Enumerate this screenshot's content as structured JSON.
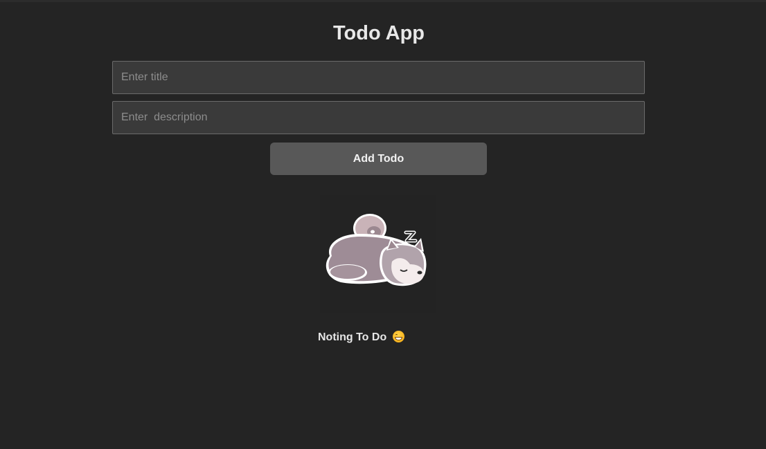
{
  "app": {
    "title": "Todo App"
  },
  "form": {
    "title_placeholder": "Enter title",
    "title_value": "",
    "description_placeholder": "Enter  description",
    "description_value": "",
    "add_button_label": "Add Todo"
  },
  "empty_state": {
    "illustration": "sleeping-husky-plush-illustration",
    "message": "Noting To Do",
    "emoji": "grinning-face-emoji"
  }
}
